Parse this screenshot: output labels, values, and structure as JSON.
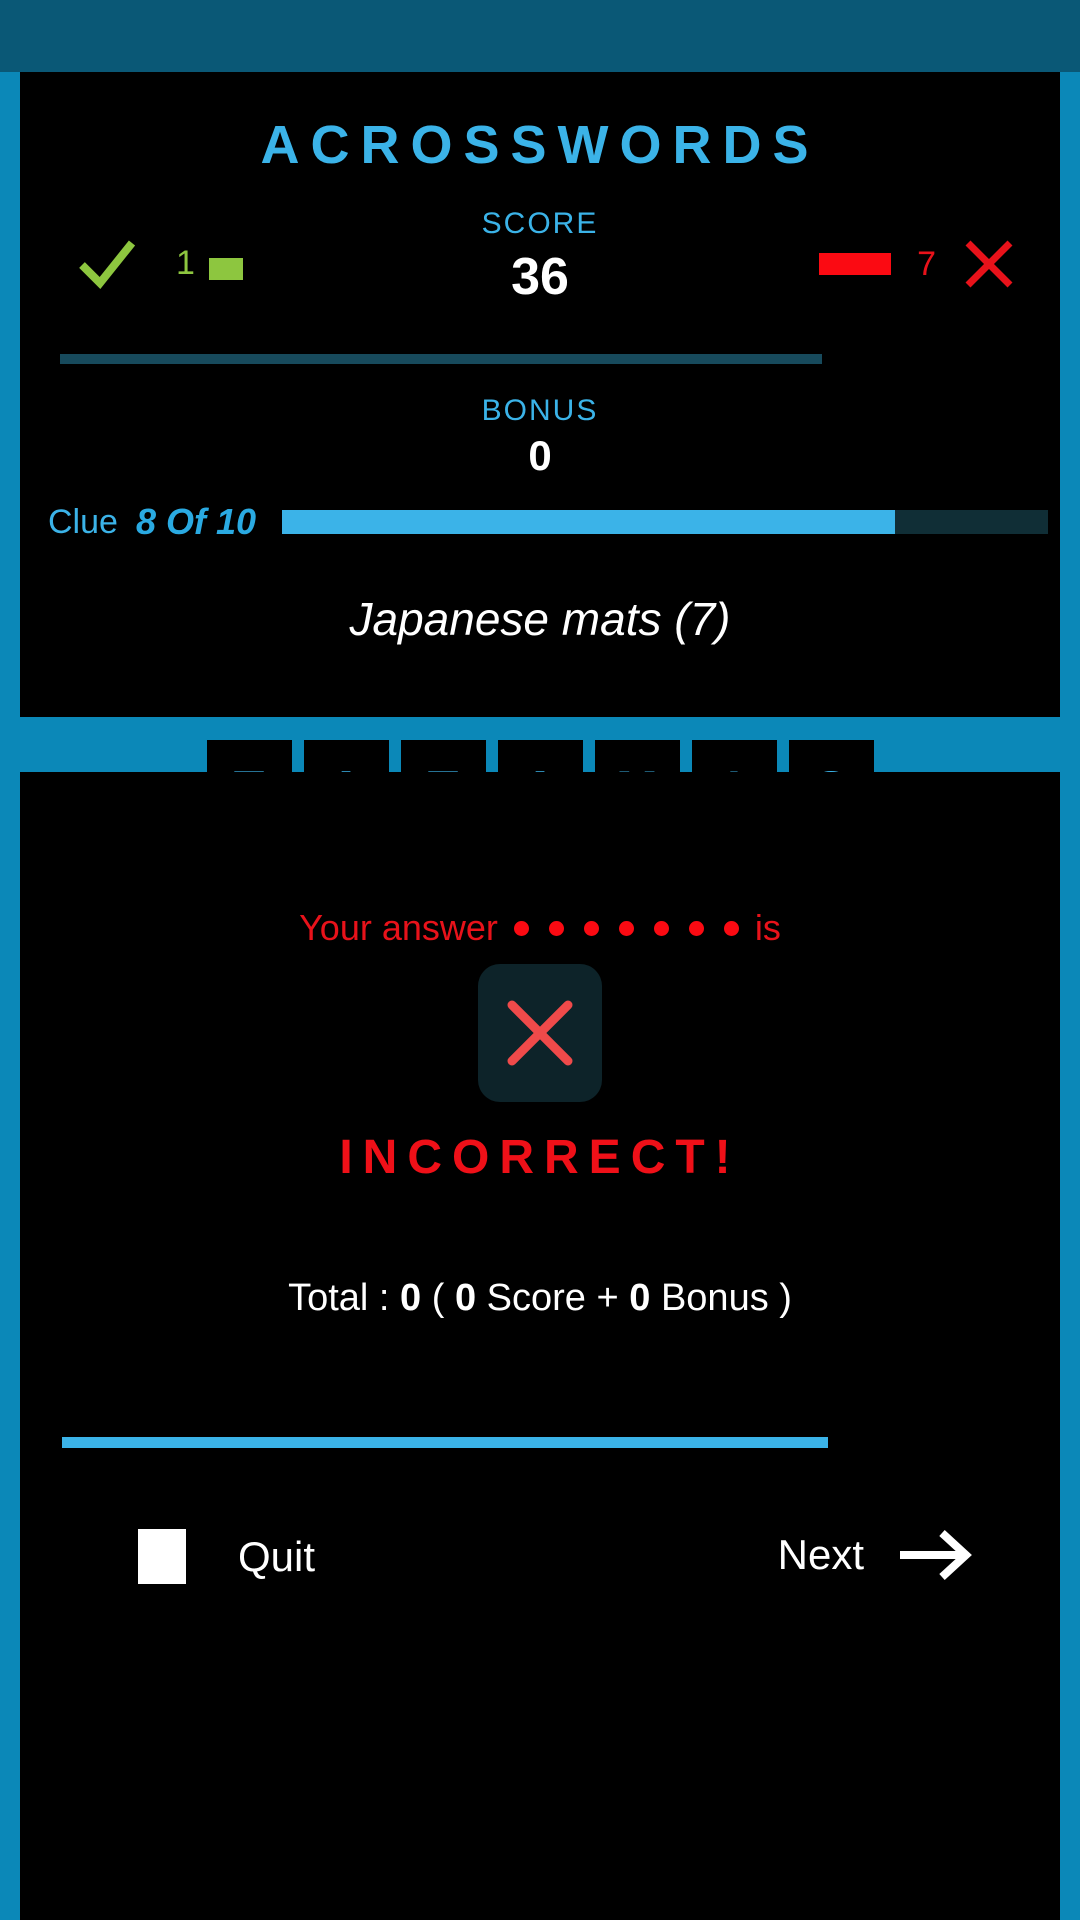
{
  "app": {
    "title": "ACROSSWORDS",
    "accent_blue": "#3bb3e8",
    "page_blue": "#0b88b8",
    "status_blue": "#0a5876",
    "panel_black": "#000000",
    "correct_green": "#8dc63f",
    "wrong_red": "#e8121a"
  },
  "scoreboard": {
    "score_label": "SCORE",
    "score_value": "36",
    "correct_count": "1",
    "wrong_count": "7",
    "check_icon": "check-icon",
    "cross_icon": "cross-icon",
    "bonus_label": "BONUS",
    "bonus_value": "0"
  },
  "clue": {
    "label": "Clue",
    "counter": "8 Of 10",
    "progress_percent": 80,
    "text": "Japanese mats (7)"
  },
  "answer_tiles": [
    {
      "letter": "T"
    },
    {
      "letter": "A"
    },
    {
      "letter": "T"
    },
    {
      "letter": "A"
    },
    {
      "letter": "M"
    },
    {
      "letter": "I"
    },
    {
      "letter": "S"
    }
  ],
  "result": {
    "answer_prefix": "Your answer",
    "answer_suffix": "is",
    "masked_dots": 7,
    "badge_icon": "cross-icon",
    "verdict": "INCORRECT!",
    "total_prefix": "Total :",
    "total_value": "0",
    "open_paren": "(",
    "score_value": "0",
    "score_word": "Score",
    "plus": "+",
    "bonus_value": "0",
    "bonus_word": "Bonus",
    "close_paren": ")"
  },
  "actions": {
    "quit_label": "Quit",
    "quit_icon": "stop-square-icon",
    "next_label": "Next",
    "next_icon": "arrow-right-icon"
  }
}
